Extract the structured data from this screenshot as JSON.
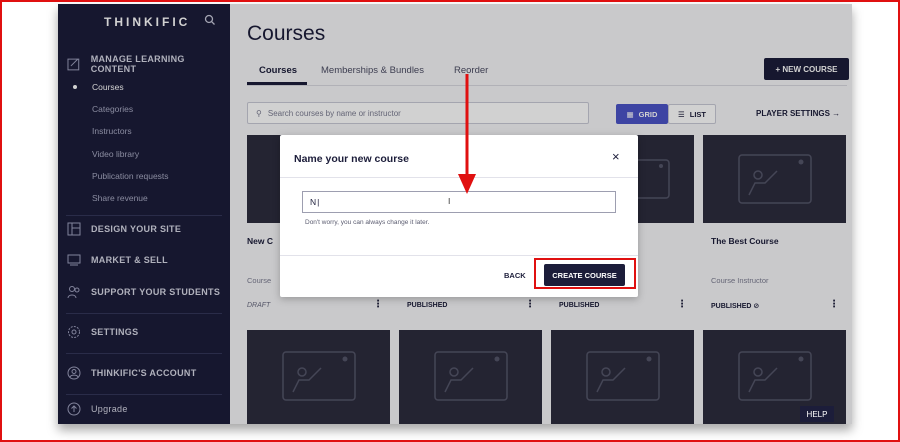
{
  "sidebar": {
    "logo": "THINKIFIC",
    "sections": [
      {
        "label": "MANAGE LEARNING CONTENT",
        "icon": "edit-icon"
      },
      {
        "label": "DESIGN YOUR SITE",
        "icon": "layout-icon"
      },
      {
        "label": "MARKET & SELL",
        "icon": "cart-icon"
      },
      {
        "label": "SUPPORT YOUR STUDENTS",
        "icon": "users-icon"
      },
      {
        "label": "SETTINGS",
        "icon": "gear-icon"
      },
      {
        "label": "THINKIFIC'S ACCOUNT",
        "icon": "account-icon"
      },
      {
        "label": "Upgrade",
        "icon": "upgrade-icon"
      }
    ],
    "sub_items": [
      "Courses",
      "Categories",
      "Instructors",
      "Video library",
      "Publication requests",
      "Share revenue"
    ]
  },
  "main": {
    "title": "Courses",
    "tabs": [
      "Courses",
      "Memberships & Bundles",
      "Reorder"
    ],
    "new_course_label": "+ NEW COURSE",
    "search_placeholder": "Search courses by name or instructor",
    "grid_label": "GRID",
    "list_label": "LIST",
    "player_settings_label": "PLAYER SETTINGS →",
    "cards": [
      {
        "title": "New C",
        "sub": "Course",
        "status": "DRAFT"
      },
      {
        "title": "",
        "sub": "",
        "status": "PUBLISHED"
      },
      {
        "title": "",
        "sub": "",
        "status": "PUBLISHED"
      },
      {
        "title": "The Best Course",
        "sub": "Course Instructor",
        "status": "PUBLISHED"
      }
    ],
    "help_label": "HELP"
  },
  "modal": {
    "title": "Name your new course",
    "close": "×",
    "input_value": "N",
    "hint": "Don't worry, you can always change it later.",
    "back_label": "BACK",
    "create_label": "CREATE COURSE"
  },
  "colors": {
    "sidebar": "#1c1d3a",
    "accent": "#4b53c7",
    "annotation": "#e01010"
  }
}
